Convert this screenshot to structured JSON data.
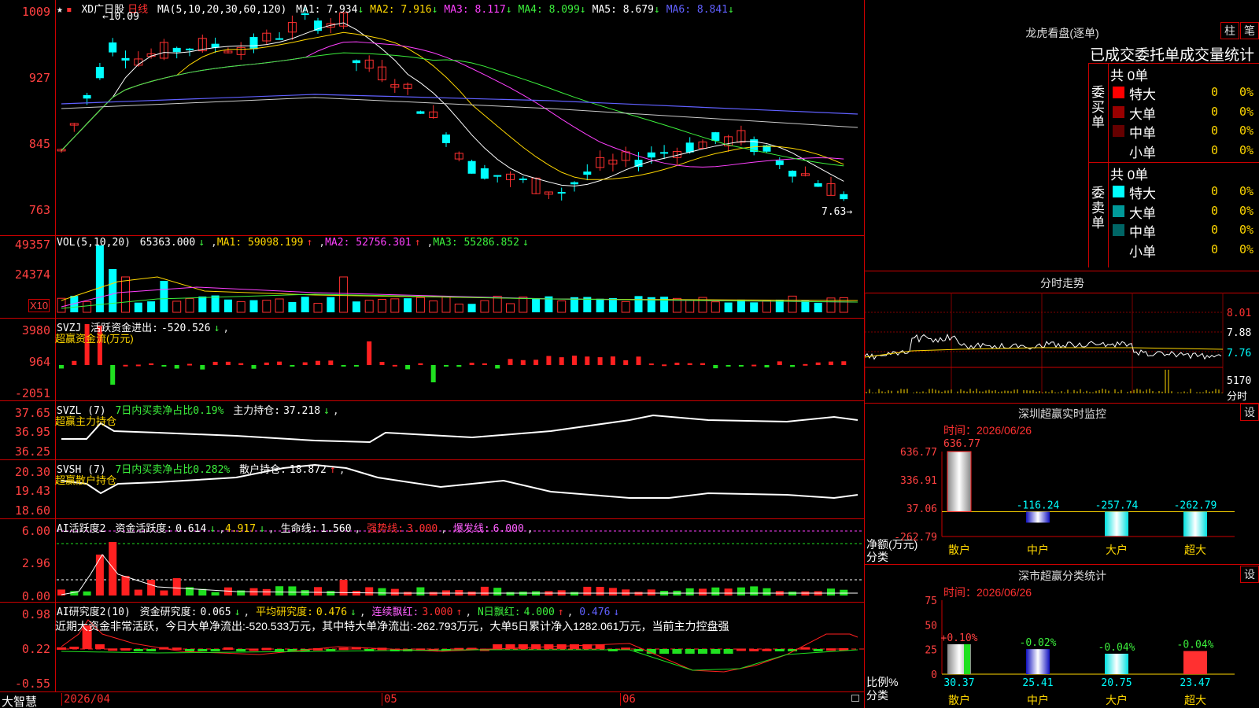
{
  "main": {
    "title_star": "★",
    "stock_name": "XD广日股",
    "period": "日线",
    "ma_spec": "MA(5,10,20,30,60,120)",
    "ma_values": [
      {
        "label": "MA1:",
        "value": "7.934",
        "arrow": "↓",
        "color": "#ffffff"
      },
      {
        "label": "MA2:",
        "value": "7.916",
        "arrow": "↓",
        "color": "#ffd700"
      },
      {
        "label": "MA3:",
        "value": "8.117",
        "arrow": "↓",
        "color": "#ff40ff"
      },
      {
        "label": "MA4:",
        "value": "8.099",
        "arrow": "↓",
        "color": "#3cf03c"
      },
      {
        "label": "MA5:",
        "value": "8.679",
        "arrow": "↓",
        "color": "#ffffff"
      },
      {
        "label": "MA6:",
        "value": "8.841",
        "arrow": "↓",
        "color": "#6060ff"
      }
    ],
    "y_ticks": [
      "1009",
      "927",
      "845",
      "763"
    ],
    "high_label": "10.09",
    "low_label": "7.63"
  },
  "vol": {
    "header": "VOL(5,10,20)",
    "value": "65363.000",
    "value_arrow": "↓",
    "ma1": "59098.199",
    "ma1_arrow": "↑",
    "ma2": "52756.301",
    "ma2_arrow": "↑",
    "ma3": "55286.852",
    "ma3_arrow": "↓",
    "y_ticks": [
      "49357",
      "24374"
    ],
    "unit": "X10"
  },
  "svzj": {
    "header": "SVZJ",
    "title": "活跃资金进出:",
    "value": "-520.526",
    "arrow": "↓",
    "subtitle": "超赢资金流(万元)",
    "y_ticks": [
      "3980",
      "964",
      "-2051"
    ]
  },
  "svzl": {
    "header": "SVZL (7)",
    "desc": "7日内买卖净占比0.19%",
    "label": "主力持仓:",
    "value": "37.218",
    "arrow": "↓",
    "subtitle": "超赢主力持仓",
    "y_ticks": [
      "37.65",
      "36.95",
      "36.25"
    ]
  },
  "svsh": {
    "header": "SVSH (7)",
    "desc": "7日内买卖净占比0.282%",
    "label": "散户持仓:",
    "value": "18.872",
    "arrow": "↑",
    "subtitle": "超赢散户持仓",
    "y_ticks": [
      "20.30",
      "19.43",
      "18.60"
    ]
  },
  "ai_active": {
    "header": "AI活跃度2",
    "label": "资金活跃度:",
    "v1": "0.614",
    "a1": "↓",
    "v2": "4.917",
    "a2": "↓",
    "life_label": "生命线:",
    "life": "1.560",
    "strong_label": "强势线:",
    "strong": "3.000",
    "burst_label": "爆发线:",
    "burst": "6.000",
    "y_ticks": [
      "6.00",
      "2.96",
      "0.00"
    ]
  },
  "ai_research": {
    "header": "AI研究度2(10)",
    "label": "资金研究度:",
    "v1": "0.065",
    "a1": "↓",
    "avg_label": "平均研究度:",
    "avg": "0.476",
    "avg_arrow": "↓",
    "red_label": "连续飘红:",
    "red": "3.000",
    "red_arrow": "↑",
    "nred_label": "N日飘红:",
    "nred": "4.000",
    "nred_arrow": "↑",
    "blue_val": "0.476",
    "blue_arrow": "↓",
    "comment": "近期大资金非常活跃，今日大单净流出:-520.533万元，其中特大单净流出:-262.793万元，大单5日累计净入1282.061万元，当前主力控盘强",
    "y_ticks": [
      "0.98",
      "0.22",
      "-0.55"
    ]
  },
  "footer": {
    "brand": "大智慧",
    "dates": [
      "2026/04",
      "05",
      "06"
    ],
    "lock_icon": "lock-icon"
  },
  "dragon": {
    "title": "龙虎看盘(逐单)",
    "btn_bar": "柱",
    "btn_count": "笔",
    "tabs_text": "已成交委托单成交量统计",
    "buy_label": "委买单",
    "sell_label": "委卖单",
    "buy_total": "共 0单",
    "sell_total": "共 0单",
    "buy_rows": [
      {
        "name": "特大",
        "count": "0",
        "pct": "0%",
        "color": "#ff0000"
      },
      {
        "name": "大单",
        "count": "0",
        "pct": "0%",
        "color": "#990000"
      },
      {
        "name": "中单",
        "count": "0",
        "pct": "0%",
        "color": "#660000"
      },
      {
        "name": "小单",
        "count": "0",
        "pct": "0%",
        "color": "#000000"
      }
    ],
    "sell_rows": [
      {
        "name": "特大",
        "count": "0",
        "pct": "0%",
        "color": "#00ffff"
      },
      {
        "name": "大单",
        "count": "0",
        "pct": "0%",
        "color": "#009999"
      },
      {
        "name": "中单",
        "count": "0",
        "pct": "0%",
        "color": "#006666"
      },
      {
        "name": "小单",
        "count": "0",
        "pct": "0%",
        "color": "#000000"
      }
    ]
  },
  "intraday": {
    "title": "分时走势",
    "y_labels": [
      "8.01",
      "7.88",
      "7.76"
    ],
    "vol_label": "5170",
    "vol_unit": "分时"
  },
  "monitor": {
    "title": "深圳超赢实时监控",
    "settings": "设",
    "time_label": "时间：2026/06/26",
    "y_ticks": [
      "636.77",
      "336.91",
      "37.06",
      "-262.79"
    ],
    "y_axis_label": "净额(万元)",
    "x_axis_label": "分类",
    "top_value": "636.77",
    "bars": [
      {
        "cat": "散户",
        "value": 636.77,
        "label": ""
      },
      {
        "cat": "中户",
        "value": -116.24,
        "label": "-116.24"
      },
      {
        "cat": "大户",
        "value": -257.74,
        "label": "-257.74"
      },
      {
        "cat": "超大",
        "value": -262.79,
        "label": "-262.79"
      }
    ]
  },
  "classify": {
    "title": "深市超赢分类统计",
    "settings": "设",
    "time_label": "时间：2026/06/26",
    "y_ticks": [
      "75",
      "50",
      "25",
      "0"
    ],
    "y_axis_label": "比例%",
    "x_axis_label": "分类",
    "bars": [
      {
        "cat": "散户",
        "value": 30.37,
        "change": "+0.10%"
      },
      {
        "cat": "中户",
        "value": 25.41,
        "change": "-0.02%"
      },
      {
        "cat": "大户",
        "value": 20.75,
        "change": "-0.04%"
      },
      {
        "cat": "超大",
        "value": 23.47,
        "change": "-0.04%"
      }
    ]
  }
}
